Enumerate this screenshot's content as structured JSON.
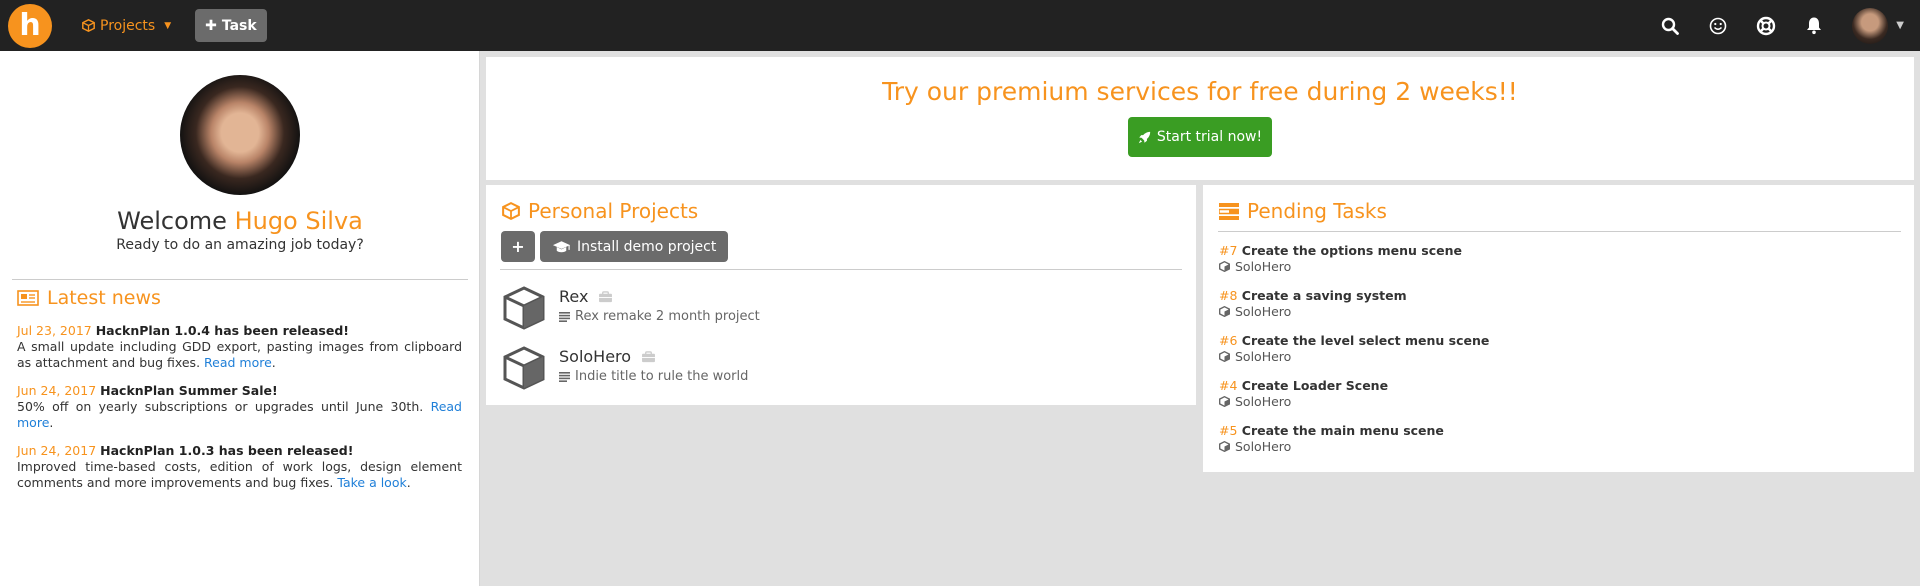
{
  "navbar": {
    "logo_letter": "h",
    "projects_label": "Projects",
    "task_label": "Task",
    "icons": [
      "search-icon",
      "smiley-icon",
      "lifebuoy-icon",
      "bell-icon"
    ]
  },
  "sidebar": {
    "welcome_prefix": "Welcome",
    "user_name": "Hugo Silva",
    "subtitle": "Ready to do an amazing job today?",
    "news_title": "Latest news",
    "news": [
      {
        "date": "Jul 23, 2017",
        "headline": "HacknPlan 1.0.4 has been released!",
        "text": "A small update including GDD export, pasting images from clipboard as attachment and bug fixes.",
        "link": "Read more"
      },
      {
        "date": "Jun 24, 2017",
        "headline": "HacknPlan Summer Sale!",
        "text": "50% off on yearly subscriptions or upgrades until June 30th.",
        "link": "Read more"
      },
      {
        "date": "Jun 24, 2017",
        "headline": "HacknPlan 1.0.3 has been released!",
        "text": "Improved time-based costs, edition of work logs, design element comments and more improvements and bug fixes.",
        "link": "Take a look"
      }
    ]
  },
  "banner": {
    "title": "Try our premium services for free during 2 weeks!!",
    "trial_button": "Start trial now!"
  },
  "projects": {
    "title": "Personal Projects",
    "add_button": "+",
    "demo_button": "Install demo project",
    "items": [
      {
        "name": "Rex",
        "description": "Rex remake 2 month project"
      },
      {
        "name": "SoloHero",
        "description": "Indie title to rule the world"
      }
    ]
  },
  "tasks": {
    "title": "Pending Tasks",
    "items": [
      {
        "number": "#7",
        "title": "Create the options menu scene",
        "project": "SoloHero"
      },
      {
        "number": "#8",
        "title": "Create a saving system",
        "project": "SoloHero"
      },
      {
        "number": "#6",
        "title": "Create the level select menu scene",
        "project": "SoloHero"
      },
      {
        "number": "#4",
        "title": "Create Loader Scene",
        "project": "SoloHero"
      },
      {
        "number": "#5",
        "title": "Create the main menu scene",
        "project": "SoloHero"
      }
    ]
  },
  "colors": {
    "accent": "#f7931e",
    "navbar": "#222222",
    "trial_button": "#3a9d23",
    "link": "#1f7fd8"
  }
}
